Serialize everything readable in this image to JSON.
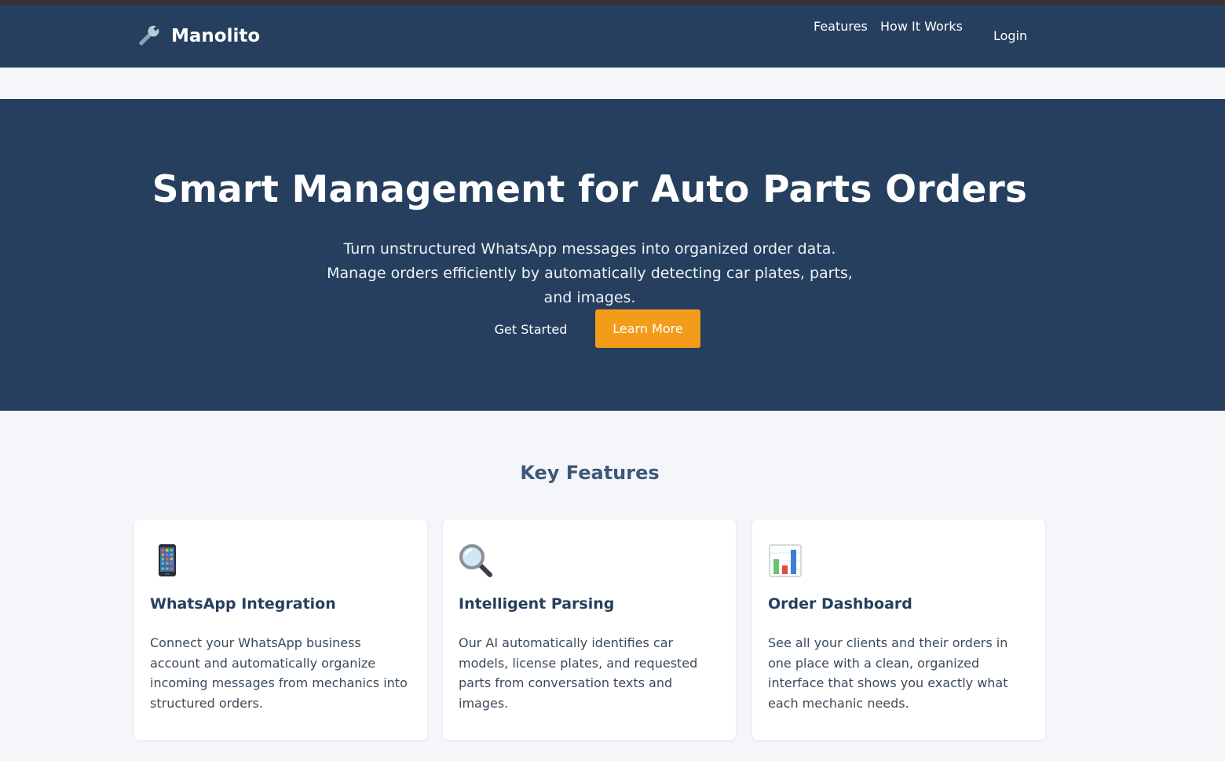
{
  "brand": {
    "name": "Manolito",
    "icon": "wrench-icon"
  },
  "nav": {
    "features": "Features",
    "how_it_works": "How It Works",
    "login": "Login"
  },
  "hero": {
    "title": "Smart Management for Auto Parts Orders",
    "subtitle": "Turn unstructured WhatsApp messages into organized order data. Manage orders efficiently by automatically detecting car plates, parts, and images.",
    "get_started": "Get Started",
    "learn_more": "Learn More"
  },
  "features": {
    "title": "Key Features",
    "items": [
      {
        "icon": "mobile-phone-icon",
        "title": "WhatsApp Integration",
        "text": "Connect your WhatsApp business account and automatically organize incoming messages from mechanics into structured orders."
      },
      {
        "icon": "magnifying-glass-icon",
        "title": "Intelligent Parsing",
        "text": "Our AI automatically identifies car models, license plates, and requested parts from conversation texts and images."
      },
      {
        "icon": "bar-chart-icon",
        "title": "Order Dashboard",
        "text": "See all your clients and their orders in one place with a clean, organized interface that shows you exactly what each mechanic needs."
      }
    ]
  },
  "colors": {
    "navy": "#263f5e",
    "accent": "#f39c1a",
    "page_bg": "#f5f6fa",
    "section_title": "#3d5878"
  }
}
